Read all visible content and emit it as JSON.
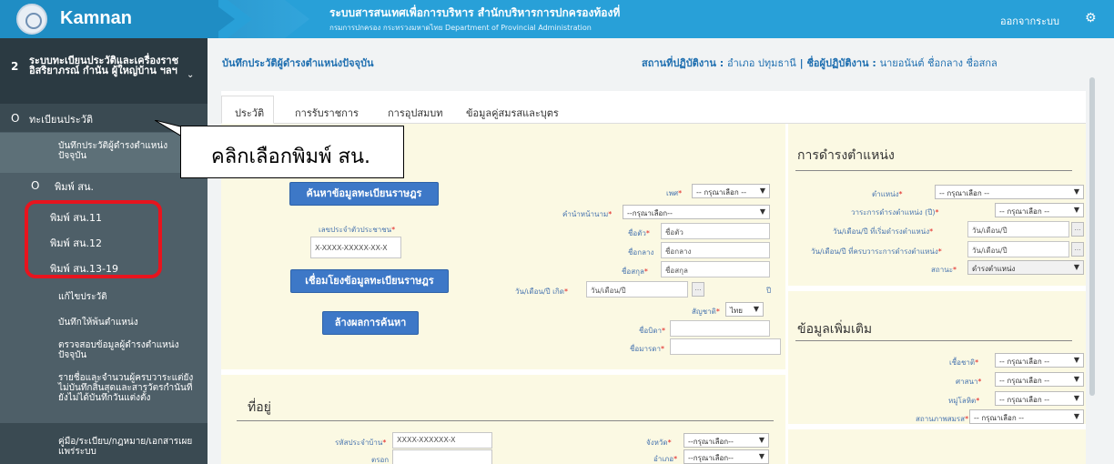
{
  "header": {
    "app_name": "Kamnan",
    "system_title": "ระบบสารสนเทศเพื่อการบริหาร สำนักบริหารการปกครองท้องที่",
    "system_subtitle": "กรมการปกครอง กระทรวงมหาดไทย Department of Provincial Administration",
    "logout": "ออกจากระบบ",
    "settings_icon": "gear-icon"
  },
  "sidebar": {
    "module_number": "2",
    "module_title": "ระบบทะเบียนประวัติและเครื่องราชอิสริยาภรณ์ กำนัน ผู้ใหญ่บ้าน ฯลฯ",
    "group_title": "ทะเบียนประวัติ",
    "items": [
      {
        "label": "บันทึกประวัติผู้ดำรงตำแหน่งปัจจุบัน"
      },
      {
        "label": "พิมพ์ สน."
      },
      {
        "label": "พิมพ์ สน.11"
      },
      {
        "label": "พิมพ์ สน.12"
      },
      {
        "label": "พิมพ์ สน.13-19"
      },
      {
        "label": "แก้ไขประวัติ"
      },
      {
        "label": "บันทึกให้พ้นตำแหน่ง"
      },
      {
        "label": "ตรวจสอบข้อมูลผู้ดำรงตำแหน่งปัจจุบัน"
      },
      {
        "label": "รายชื่อและจำนวนผู้ครบวาระแต่ยังไม่บันทึกสิ้นสุดและสารวัตรกำนันที่ยังไม่ได้บันทึกวันแต่งตั้ง"
      },
      {
        "label": "คู่มือ/ระเบียบ/กฎหมาย/เอกสารเผยแพร่ระบบ"
      }
    ]
  },
  "callout": {
    "text": "คลิกเลือกพิมพ์ สน."
  },
  "page": {
    "title": "บันทึกประวัติผู้ดำรงตำแหน่งปัจจุบัน",
    "location_label": "สถานที่ปฏิบัติงาน :",
    "location_value": "อำเภอ ปทุมธานี",
    "operator_label": "ชื่อผู้ปฏิบัติงาน :",
    "operator_value": "นายอนันต์ ชื่อกลาง ชื่อสกล"
  },
  "tabs": [
    {
      "label": "ประวัติ"
    },
    {
      "label": "การรับราชการ"
    },
    {
      "label": "การอุปสมบท"
    },
    {
      "label": "ข้อมูลคู่สมรสและบุตร"
    }
  ],
  "personal": {
    "search_button": "ค้นหาข้อมูลทะเบียนราษฎร",
    "id_label": "เลขประจำตัวประชาชน",
    "id_placeholder": "X-XXXX-XXXXX-XX-X",
    "link_button": "เชื่อมโยงข้อมูลทะเบียนราษฎร",
    "clear_button": "ล้างผลการค้นหา",
    "gender_label": "เพศ",
    "gender_value": "-- กรุณาเลือก --",
    "prefix_label": "คำนำหน้านาม",
    "prefix_value": "--กรุณาเลือก--",
    "first_label": "ชื่อตัว",
    "first_placeholder": "ชื่อตัว",
    "middle_label": "ชื่อกลาง",
    "middle_placeholder": "ชื่อกลาง",
    "last_label": "ชื่อสกุล",
    "last_placeholder": "ชื่อสกุล",
    "dob_label": "วัน/เดือน/ปี เกิด",
    "dob_placeholder": "วัน/เดือน/ปี",
    "year_suffix": "ปี",
    "nationality_label": "สัญชาติ",
    "nationality_value": "ไทย",
    "father_label": "ชื่อบิดา",
    "mother_label": "ชื่อมารดา"
  },
  "address": {
    "title": "ที่อยู่",
    "house_label": "รหัสประจำบ้าน",
    "house_placeholder": "XXXX-XXXXXX-X",
    "alley_label": "ตรอก",
    "province_label": "จังหวัด",
    "province_value": "--กรุณาเลือก--",
    "district_label": "อำเภอ",
    "district_value": "--กรุณาเลือก--"
  },
  "position": {
    "title": "การดำรงตำแหน่ง",
    "position_label": "ตำแหน่ง",
    "position_value": "-- กรุณาเลือก --",
    "term_label": "วาระการดำรงตำแหน่ง (ปี)",
    "term_value": "-- กรุณาเลือก --",
    "start_label": "วัน/เดือน/ปี ที่เริ่มดำรงตำแหน่ง",
    "start_placeholder": "วัน/เดือน/ปี",
    "end_label": "วัน/เดือน/ปี ที่ครบวาระการดำรงตำแหน่ง",
    "end_placeholder": "วัน/เดือน/ปี",
    "status_label": "สถานะ",
    "status_value": "ดำรงตำแหน่ง"
  },
  "extra": {
    "title": "ข้อมูลเพิ่มเติม",
    "race_label": "เชื้อชาติ",
    "race_value": "-- กรุณาเลือก --",
    "religion_label": "ศาสนา",
    "religion_value": "-- กรุณาเลือก --",
    "blood_label": "หมู่โลหิต",
    "blood_value": "-- กรุณาเลือก --",
    "marital_label": "สถานภาพสมรส",
    "marital_value": "-- กรุณาเลือก --"
  }
}
